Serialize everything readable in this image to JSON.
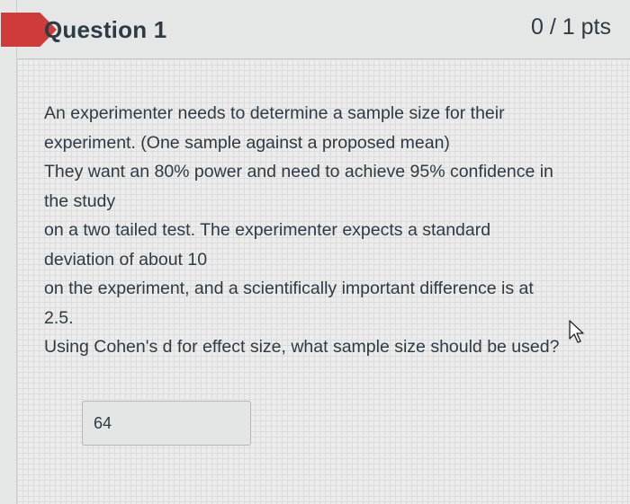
{
  "question": {
    "title": "Question 1",
    "points": "0 / 1 pts",
    "lines": [
      "An experimenter needs to determine a sample size for their",
      "experiment. (One sample against a proposed mean)",
      "They want an 80% power and need to achieve 95% confidence in",
      "the study",
      "on a two tailed test.  The experimenter expects a standard",
      "deviation of about 10",
      "on the experiment, and a scientifically important difference is at",
      "2.5.",
      "Using Cohen's d for effect size, what sample size should be used?"
    ],
    "answer_value": "64"
  },
  "colors": {
    "flag": "#cf3a3a",
    "text": "#2d3b45"
  },
  "icons": {
    "cursor": "mouse-pointer-icon"
  }
}
